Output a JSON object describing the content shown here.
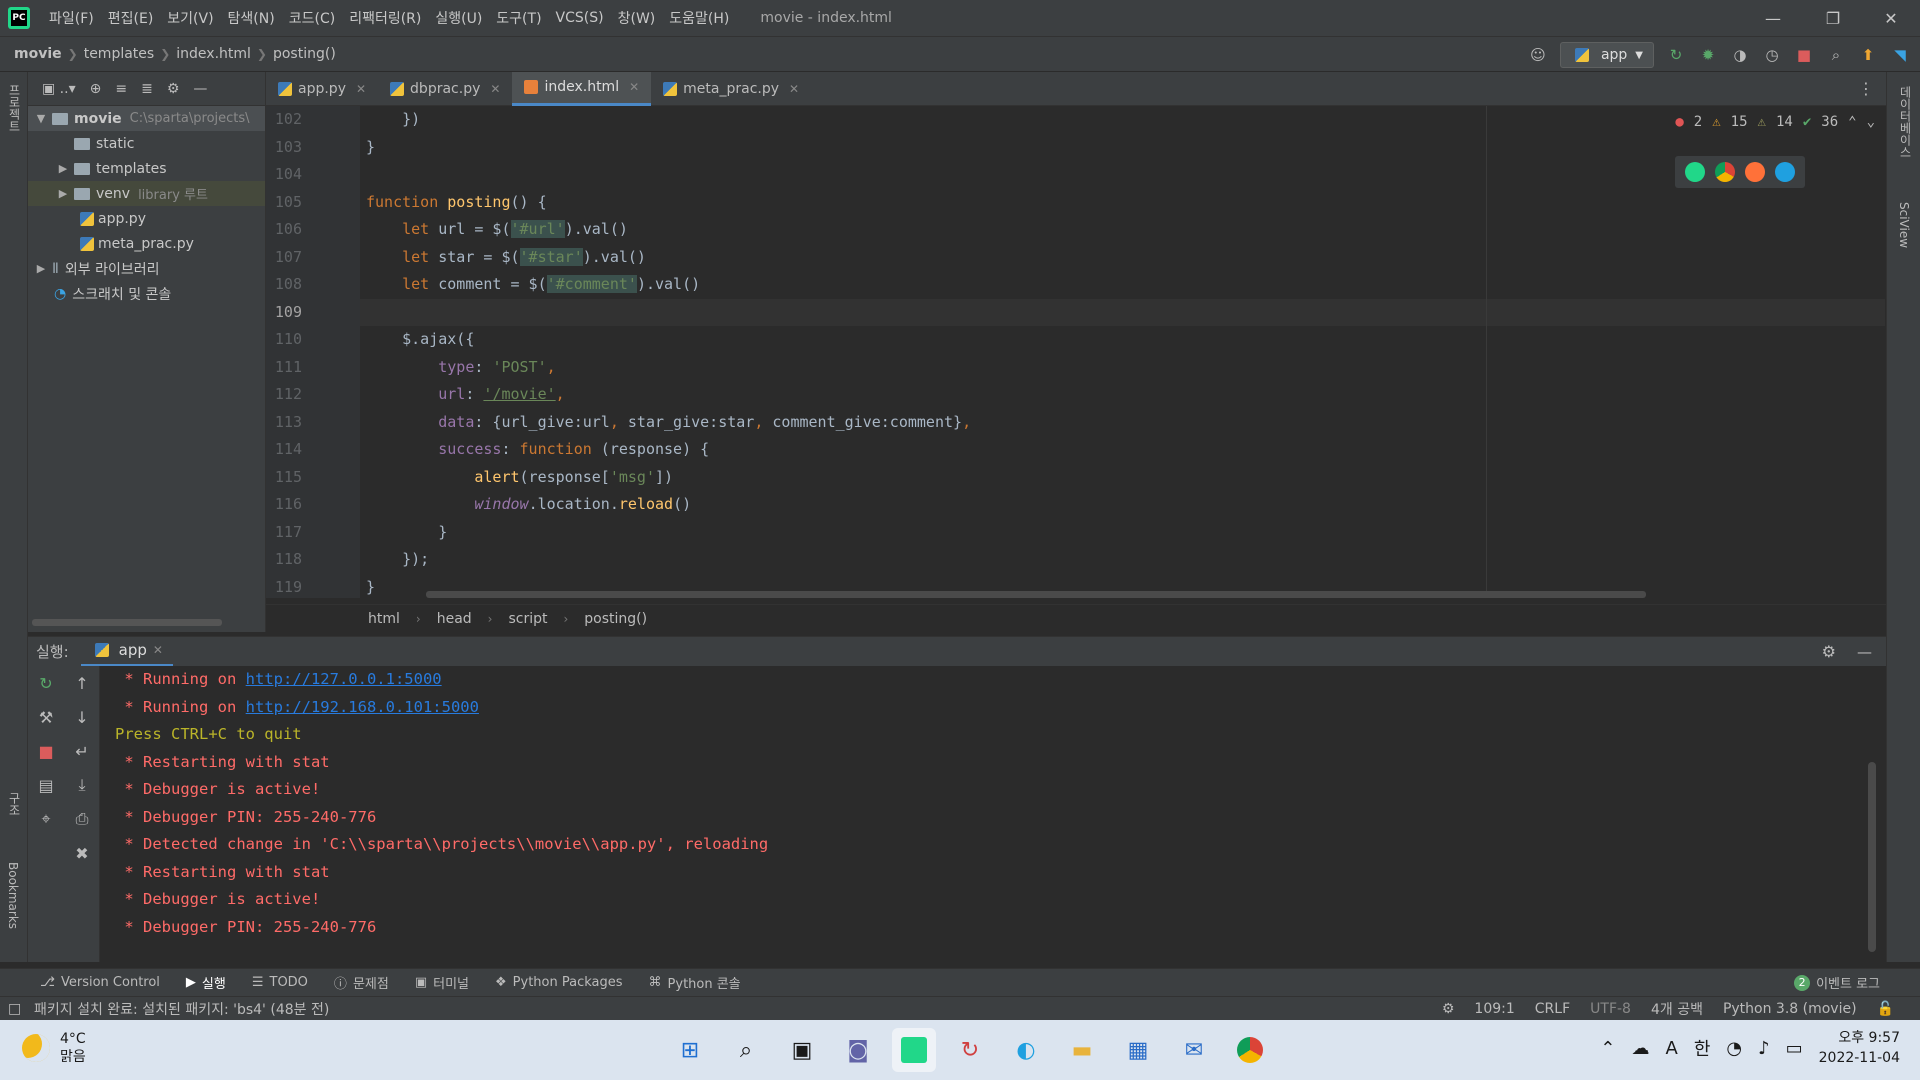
{
  "window": {
    "title": "movie - index.html",
    "menu": [
      "파일(F)",
      "편집(E)",
      "보기(V)",
      "탐색(N)",
      "코드(C)",
      "리팩터링(R)",
      "실행(U)",
      "도구(T)",
      "VCS(S)",
      "창(W)",
      "도움말(H)"
    ]
  },
  "nav": {
    "crumbs": [
      "movie",
      "templates",
      "index.html",
      "posting()"
    ],
    "run_config": "app"
  },
  "left_strip": {
    "project_label": "프로젝트",
    "structure_label": "구조",
    "bookmarks_label": "Bookmarks"
  },
  "right_strip": {
    "database_label": "데이터베이스",
    "sciview_label": "SciView"
  },
  "project": {
    "root": "movie",
    "root_path": "C:\\sparta\\projects\\",
    "items": [
      {
        "label": "static",
        "type": "folder"
      },
      {
        "label": "templates",
        "type": "folder"
      },
      {
        "label": "venv",
        "extra": "library 루트",
        "type": "folder"
      },
      {
        "label": "app.py",
        "type": "py"
      },
      {
        "label": "meta_prac.py",
        "type": "py"
      }
    ],
    "external_libs": "외부 라이브러리",
    "scratches": "스크래치 및 콘솔"
  },
  "tabs": [
    {
      "label": "app.py"
    },
    {
      "label": "dbprac.py"
    },
    {
      "label": "index.html"
    },
    {
      "label": "meta_prac.py"
    }
  ],
  "inspection": {
    "errors": "2",
    "warnings": "15",
    "weak_warnings": "14",
    "typos": "36"
  },
  "editor": {
    "line_numbers": [
      "102",
      "103",
      "104",
      "105",
      "106",
      "107",
      "108",
      "109",
      "110",
      "111",
      "112",
      "113",
      "114",
      "115",
      "116",
      "117",
      "118",
      "119"
    ],
    "current_line": "109",
    "lines": {
      "l102": "    })",
      "l103": "}",
      "l105a": "function",
      "l105b": " posting",
      "l105c": "() {",
      "l106a": "    let",
      "l106b": " url = $(",
      "l106c": "'#url'",
      "l106d": ").val()",
      "l107a": "    let",
      "l107b": " star = $(",
      "l107c": "'#star'",
      "l107d": ").val()",
      "l108a": "    let",
      "l108b": " comment = $(",
      "l108c": "'#comment'",
      "l108d": ").val()",
      "l110": "    $.ajax({",
      "l111a": "        type",
      "l111b": ": ",
      "l111c": "'POST'",
      "l111d": ",",
      "l112a": "        url",
      "l112b": ": ",
      "l112c": "'/movie'",
      "l112d": ",",
      "l113a": "        data",
      "l113b": ": {url_give:url",
      "l113c": ",",
      "l113d": " star_give:star",
      "l113e": ",",
      "l113f": " comment_give:comment}",
      "l113g": ",",
      "l114a": "        success",
      "l114b": ": ",
      "l114c": "function",
      "l114d": " (response) {",
      "l115a": "            alert",
      "l115b": "(response[",
      "l115c": "'msg'",
      "l115d": "])",
      "l116a": "            window",
      "l116b": ".location.",
      "l116c": "reload",
      "l116d": "()",
      "l117": "        }",
      "l118": "    });",
      "l119": "}"
    },
    "crumbs": [
      "html",
      "head",
      "script",
      "posting()"
    ]
  },
  "run": {
    "label": "실행:",
    "tab": "app",
    "console": [
      {
        "text": " * Running on ",
        "link": "http://127.0.0.1:5000",
        "cls": "err"
      },
      {
        "text": " * Running on ",
        "link": "http://192.168.0.101:5000",
        "cls": "err"
      },
      {
        "text": "Press CTRL+C to quit",
        "cls": "warn"
      },
      {
        "text": " * Restarting with stat",
        "cls": "err"
      },
      {
        "text": " * Debugger is active!",
        "cls": "err"
      },
      {
        "text": " * Debugger PIN: 255-240-776",
        "cls": "err"
      },
      {
        "text": " * Detected change in 'C:\\\\sparta\\\\projects\\\\movie\\\\app.py', reloading",
        "cls": "err"
      },
      {
        "text": " * Restarting with stat",
        "cls": "err"
      },
      {
        "text": " * Debugger is active!",
        "cls": "err"
      },
      {
        "text": " * Debugger PIN: 255-240-776",
        "cls": "err"
      }
    ]
  },
  "tool_tabs": [
    "Version Control",
    "실행",
    "TODO",
    "문제점",
    "터미널",
    "Python Packages",
    "Python 콘솔"
  ],
  "event_log": {
    "count": "2",
    "label": "이벤트 로그"
  },
  "status": {
    "message": "패키지 설치 완료: 설치된 패키지: 'bs4' (48분 전)",
    "position": "109:1",
    "line_sep": "CRLF",
    "encoding": "UTF-8",
    "indent": "4개 공백",
    "interpreter": "Python 3.8 (movie)"
  },
  "taskbar": {
    "temp": "4°C",
    "condition": "맑음",
    "ime": "한",
    "time": "오후 9:57",
    "date": "2022-11-04"
  }
}
